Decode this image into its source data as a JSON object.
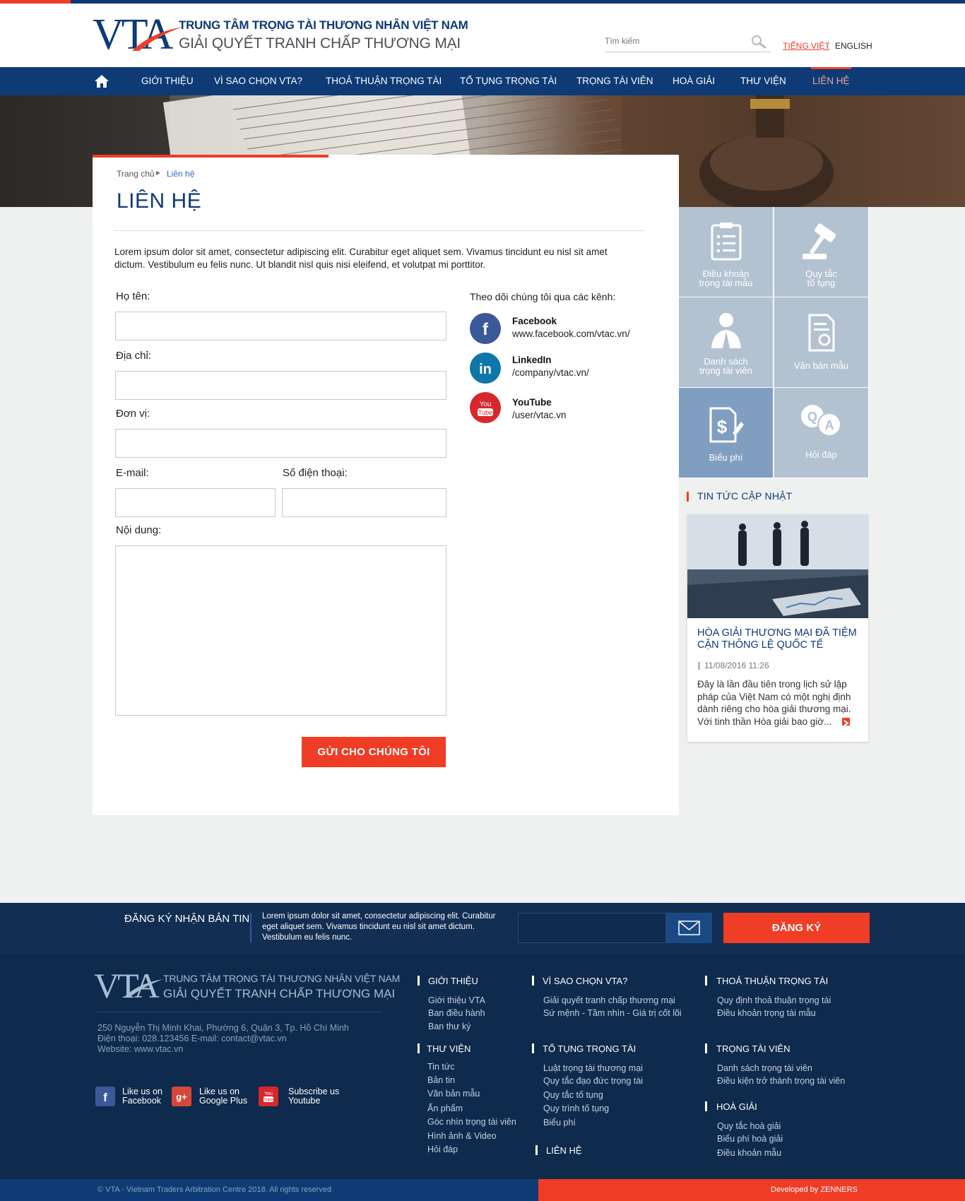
{
  "header": {
    "org_line1": "TRUNG TÂM TRỌNG TÀI THƯƠNG NHÂN VIỆT NAM",
    "org_line2": "GIẢI QUYẾT TRANH CHẤP THƯƠNG MẠI",
    "logo_text": "VTA",
    "search_placeholder": "Tìm kiếm",
    "lang_vi": "TIẾNG VIỆT",
    "lang_en": "ENGLISH"
  },
  "nav": {
    "items": [
      {
        "label": "GIỚI THIỆU"
      },
      {
        "label": "VÌ SAO CHỌN VTA?"
      },
      {
        "label": "THOẢ THUẬN TRỌNG TÀI"
      },
      {
        "label": "TỐ TỤNG TRỌNG TÀI"
      },
      {
        "label": "TRỌNG TÀI VIÊN"
      },
      {
        "label": "HOÀ GIẢI"
      },
      {
        "label": "THƯ VIỆN"
      },
      {
        "label": "LIÊN HỆ"
      }
    ]
  },
  "breadcrumb": {
    "home": "Trang chủ",
    "current": "Liên hệ"
  },
  "page": {
    "title": "LIÊN HỆ",
    "intro": "Lorem ipsum dolor sit amet, consectetur adipiscing elit. Curabitur eget aliquet sem. Vivamus tincidunt eu nisl sit amet dictum. Vestibulum eu felis nunc. Ut blandit nisl quis nisi eleifend, et volutpat mi porttitor."
  },
  "form": {
    "name_label": "Họ tên:",
    "address_label": "Địa chỉ:",
    "unit_label": "Đơn vị:",
    "email_label": "E-mail:",
    "phone_label": "Số điện thoại:",
    "content_label": "Nội dung:",
    "submit_label": "GỬI CHO CHÚNG TÔI"
  },
  "social": {
    "heading": "Theo dõi chúng tôi qua các kênh:",
    "channels": [
      {
        "name": "Facebook",
        "link": "www.facebook.com/vtac.vn/",
        "color": "#3b5998"
      },
      {
        "name": "LinkedIn",
        "link": "/company/vtac.vn/",
        "color": "#0e76a8"
      },
      {
        "name": "YouTube",
        "link": "/user/vtac.vn",
        "color": "#d7262c"
      }
    ]
  },
  "tiles": [
    {
      "label1": "Điều khoản",
      "label2": "trọng tài mẫu",
      "icon": "clipboard-icon"
    },
    {
      "label1": "Quy tắc",
      "label2": "tố tụng",
      "icon": "gavel-icon"
    },
    {
      "label1": "Danh sách",
      "label2": "trọng tài viên",
      "icon": "arbitrator-icon"
    },
    {
      "label1": "Văn bản mẫu",
      "label2": "",
      "icon": "certificate-icon"
    },
    {
      "label1": "Biểu phí",
      "label2": "",
      "icon": "fee-icon"
    },
    {
      "label1": "Hỏi đáp",
      "label2": "",
      "icon": "qa-icon"
    }
  ],
  "news": {
    "heading": "TIN TỨC CẬP NHẬT",
    "title": "HÒA GIẢI THƯƠNG MẠI ĐÃ TIỆM CẬN THÔNG LỆ QUỐC TẾ",
    "date": "11/08/2016 11:26",
    "excerpt": "Đây là lần đầu tiên trong lịch sử lập pháp của Việt Nam có một nghị định dành riêng cho hòa giải thương mại. Với tinh thần Hòa giải bao giờ..."
  },
  "newsletter": {
    "title": "ĐĂNG KÝ NHẬN BẢN TIN",
    "text": "Lorem ipsum dolor sit amet, consectetur adipiscing elit. Curabitur eget aliquet sem. Vivamus tincidunt eu nisl sit amet dictum. Vestibulum eu felis nunc.",
    "button": "ĐĂNG KÝ"
  },
  "footer": {
    "org_line1": "TRUNG TÂM TRỌNG TÀI THƯƠNG NHÂN VIỆT NAM",
    "org_line2": "GIẢI QUYẾT TRANH CHẤP THƯƠNG MẠI",
    "address": "250 Nguyễn Thị Minh Khai, Phường 6, Quận 3, Tp. Hồ Chí Minh",
    "phone_email": "Điện thoại: 028.123456 E-mail: contact@vtac.vn",
    "website": "Website: www.vtac.vn",
    "social": [
      {
        "line1": "Like us on",
        "line2": "Facebook"
      },
      {
        "line1": "Like us on",
        "line2": "Google Plus"
      },
      {
        "line1": "Subscribe us",
        "line2": "Youtube"
      }
    ],
    "columns": {
      "gioi_thieu": {
        "title": "GIỚI THIỆU",
        "links": [
          "Giới thiệu VTA",
          "Ban điều hành",
          "Ban thư ký"
        ]
      },
      "vi_sao": {
        "title": "VÌ SAO CHỌN VTA?",
        "links": [
          "Giải quyết tranh chấp thương mại",
          "Sứ mệnh - Tầm  nhìn - Giá trị cốt lõi"
        ]
      },
      "thoa_thuan": {
        "title": "THOẢ THUẬN TRỌNG TÀI",
        "links": [
          "Quy định thoả thuận trọng tài",
          "Điều khoản trọng tài mẫu"
        ]
      },
      "thu_vien": {
        "title": "THƯ VIỆN",
        "links": [
          "Tin tức",
          "Bản tin",
          "Văn bản mẫu",
          "Ấn phẩm",
          "Góc nhìn trọng tài viên",
          "Hình ảnh & Video",
          "Hỏi đáp"
        ]
      },
      "to_tung": {
        "title": "TỐ TỤNG TRỌNG TÀI",
        "links": [
          "Luật trọng tài thương mại",
          "Quy tắc đạo đức trọng tài",
          "Quy tắc tố tụng",
          "Quy trình tố tụng",
          "Biểu phí"
        ]
      },
      "trong_tai_vien": {
        "title": "TRỌNG TÀI VIÊN",
        "links": [
          "Danh sách trọng tài viên",
          "Điều kiện trở thành trọng tài viên"
        ]
      },
      "hoa_giai": {
        "title": "HOÀ GIẢI",
        "links": [
          "Quy tắc hoà giải",
          "Biểu phí hoà giải",
          "Điều khoản mẫu"
        ]
      },
      "lien_he": {
        "title": "LIÊN HỆ"
      }
    },
    "copyright": "© VTA - Vietnam Traders Arbitration Centre  2018. All rights reserved",
    "developer": "Developed by ZENNERS"
  },
  "colors": {
    "brand": "#0e3a75",
    "accent": "#ef3d26",
    "footer": "#0e2a4c"
  }
}
